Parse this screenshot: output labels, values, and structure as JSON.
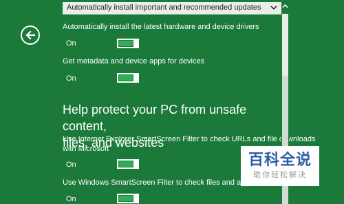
{
  "dropdown": {
    "selected": "Automatically install important and recommended updates"
  },
  "settings": {
    "drivers_label": "Automatically install the latest hardware and device drivers",
    "drivers_state": "On",
    "metadata_label": "Get metadata and device apps for devices",
    "metadata_state": "On",
    "section_heading_line1": "Help protect your PC from unsafe content,",
    "section_heading_line2": "files, and websites",
    "ie_filter_line1": "Use Internet Explorer SmartScreen Filter to check URLs and file downloads",
    "ie_filter_line2": "with Microsoft",
    "ie_filter_state": "On",
    "win_filter_label": "Use Windows SmartScreen Filter to check files and apps with Microsoft",
    "win_filter_state": "On"
  },
  "watermark": {
    "title": "百科全说",
    "subtitle": "助你轻松解决"
  },
  "icons": {
    "back": "back-arrow-icon",
    "dropdown": "chevron-down-icon",
    "scroll_up": "chevron-up-icon"
  },
  "colors": {
    "background": "#1b7a3a",
    "toggle_on": "#2fae52",
    "watermark_text": "#2a5fa8"
  }
}
